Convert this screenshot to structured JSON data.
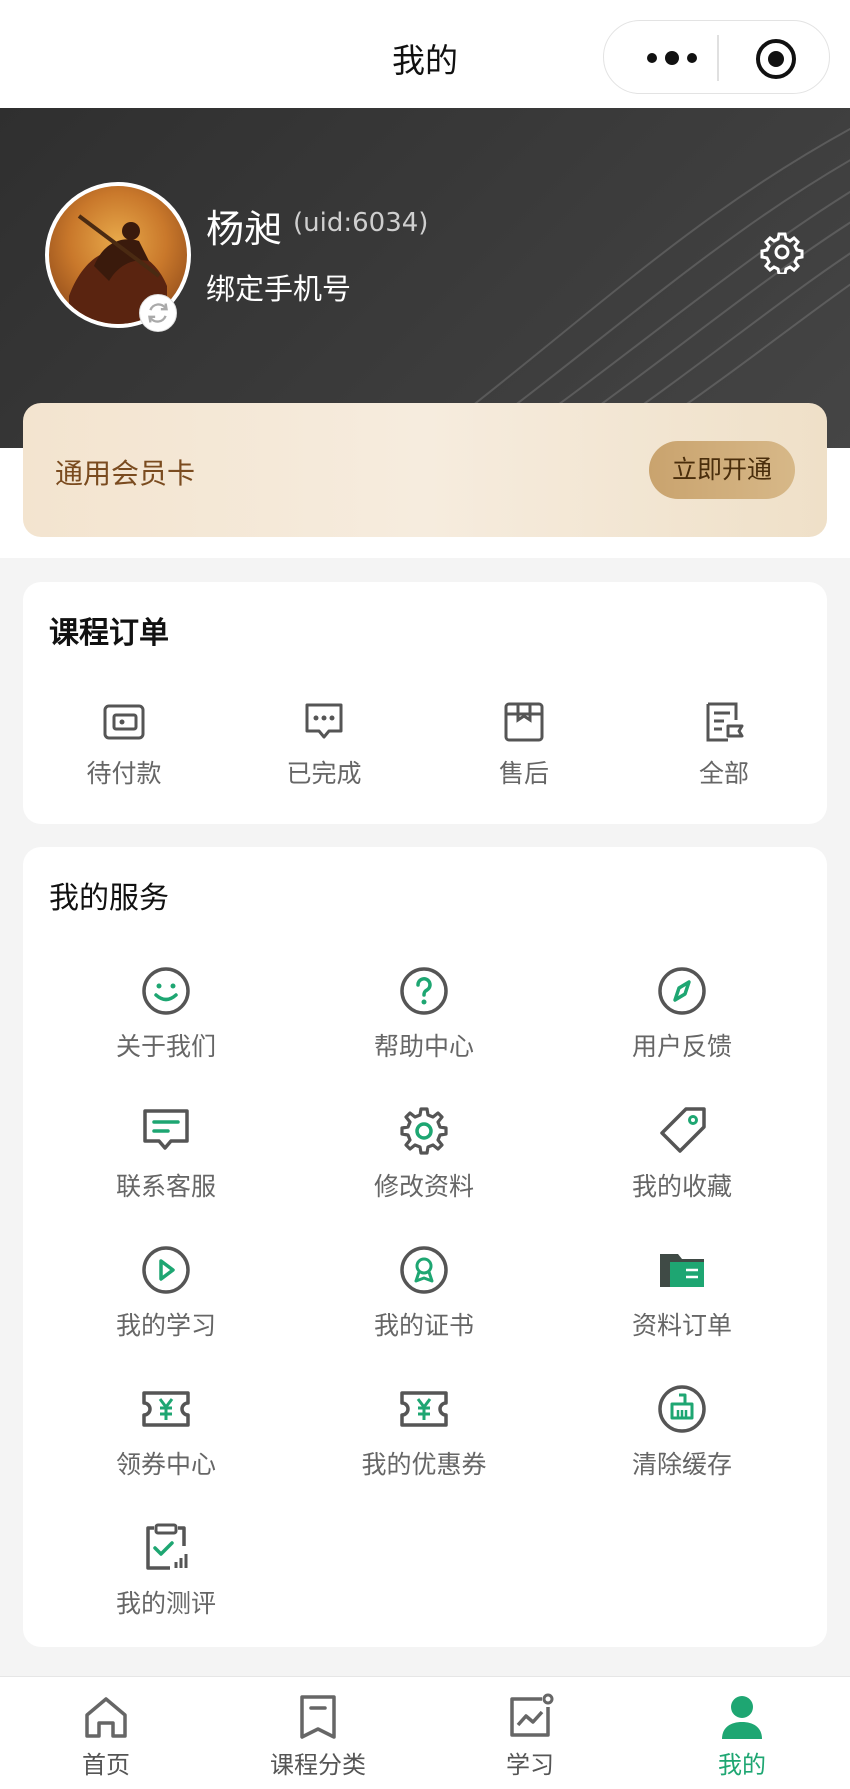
{
  "nav": {
    "title": "我的",
    "more_icon": "more-dots-icon",
    "close_icon": "target-icon"
  },
  "profile": {
    "name": "杨昶",
    "uid": "(uid:6034)",
    "bind_phone": "绑定手机号",
    "settings_icon": "gear-icon"
  },
  "member": {
    "label": "通用会员卡",
    "button": "立即开通"
  },
  "orders": {
    "title": "课程订单",
    "items": [
      {
        "label": "待付款",
        "icon": "wallet-icon"
      },
      {
        "label": "已完成",
        "icon": "message-dots-icon"
      },
      {
        "label": "售后",
        "icon": "box-icon"
      },
      {
        "label": "全部",
        "icon": "document-list-icon"
      }
    ]
  },
  "services": {
    "title": "我的服务",
    "items": [
      {
        "label": "关于我们",
        "icon": "smile-icon"
      },
      {
        "label": "帮助中心",
        "icon": "question-icon"
      },
      {
        "label": "用户反馈",
        "icon": "compass-icon"
      },
      {
        "label": "联系客服",
        "icon": "chat-icon"
      },
      {
        "label": "修改资料",
        "icon": "gear-icon"
      },
      {
        "label": "我的收藏",
        "icon": "tag-icon"
      },
      {
        "label": "我的学习",
        "icon": "play-icon"
      },
      {
        "label": "我的证书",
        "icon": "badge-icon"
      },
      {
        "label": "资料订单",
        "icon": "folder-icon"
      },
      {
        "label": "领券中心",
        "icon": "coupon-icon"
      },
      {
        "label": "我的优惠券",
        "icon": "coupon-icon"
      },
      {
        "label": "清除缓存",
        "icon": "broom-icon"
      },
      {
        "label": "我的测评",
        "icon": "clipboard-check-icon"
      }
    ]
  },
  "tabs": [
    {
      "label": "首页",
      "icon": "home-icon"
    },
    {
      "label": "课程分类",
      "icon": "bookmark-icon"
    },
    {
      "label": "学习",
      "icon": "chart-icon"
    },
    {
      "label": "我的",
      "icon": "user-icon",
      "active": true
    }
  ],
  "colors": {
    "accent": "#1ea672",
    "header_bg": "#333333",
    "member_text": "#7a4b1f"
  }
}
